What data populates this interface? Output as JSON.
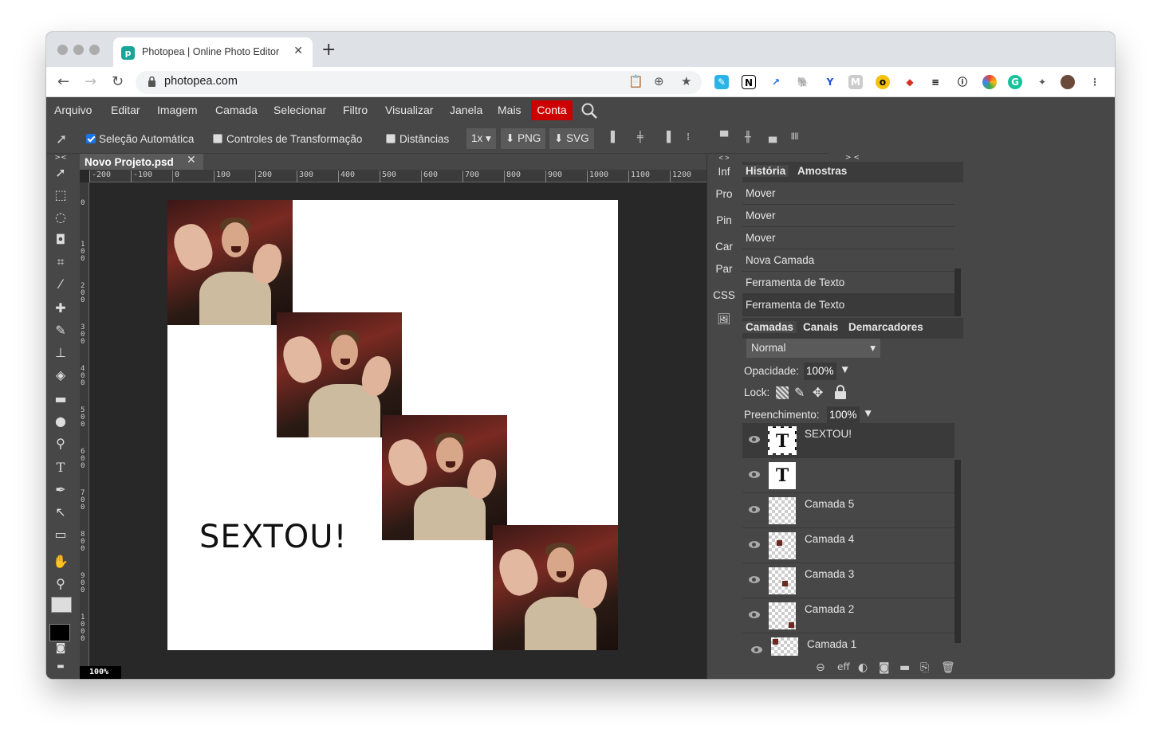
{
  "browser": {
    "tab_title": "Photopea | Online Photo Editor",
    "tab_close": "✕",
    "new_tab": "+",
    "url": "photopea.com"
  },
  "menu": {
    "items": [
      "Arquivo",
      "Editar",
      "Imagem",
      "Camada",
      "Selecionar",
      "Filtro",
      "Visualizar",
      "Janela",
      "Mais"
    ],
    "account": "Conta"
  },
  "options": {
    "auto_select": "Seleção Automática",
    "transform_controls": "Controles de Transformação",
    "distances": "Distâncias",
    "scale": "1x",
    "png": "PNG",
    "svg": "SVG"
  },
  "document": {
    "tab_name": "Novo Projeto.psd",
    "close": "✕",
    "canvas_text": "SEXTOU!",
    "zoom": "100%",
    "ruler_h": [
      "-200",
      "-100",
      "0",
      "100",
      "200",
      "300",
      "400",
      "500",
      "600",
      "700",
      "800",
      "900",
      "1000",
      "1100",
      "1200"
    ],
    "ruler_v": [
      "0",
      "100",
      "200",
      "300",
      "400",
      "500",
      "600",
      "700",
      "800",
      "900",
      "1000"
    ]
  },
  "side_mini": [
    "Inf",
    "Pro",
    "Pin",
    "Car",
    "Par",
    "CSS"
  ],
  "history": {
    "tabs": [
      "História",
      "Amostras"
    ],
    "items": [
      "Mover",
      "Mover",
      "Mover",
      "Nova Camada",
      "Ferramenta de Texto",
      "Ferramenta de Texto"
    ]
  },
  "layers_panel": {
    "tabs": [
      "Camadas",
      "Canais",
      "Demarcadores"
    ],
    "blend_mode": "Normal",
    "opacity_label": "Opacidade:",
    "opacity": "100%",
    "lock_label": "Lock:",
    "fill_label": "Preenchimento:",
    "fill": "100%",
    "layers": [
      {
        "name": "SEXTOU!",
        "thumb": "T"
      },
      {
        "name": "",
        "thumb": "T"
      },
      {
        "name": "Camada 5",
        "thumb": ""
      },
      {
        "name": "Camada 4",
        "thumb": ""
      },
      {
        "name": "Camada 3",
        "thumb": ""
      },
      {
        "name": "Camada 2",
        "thumb": ""
      },
      {
        "name": "Camada 1",
        "thumb": ""
      }
    ],
    "footer_eff": "eff"
  }
}
